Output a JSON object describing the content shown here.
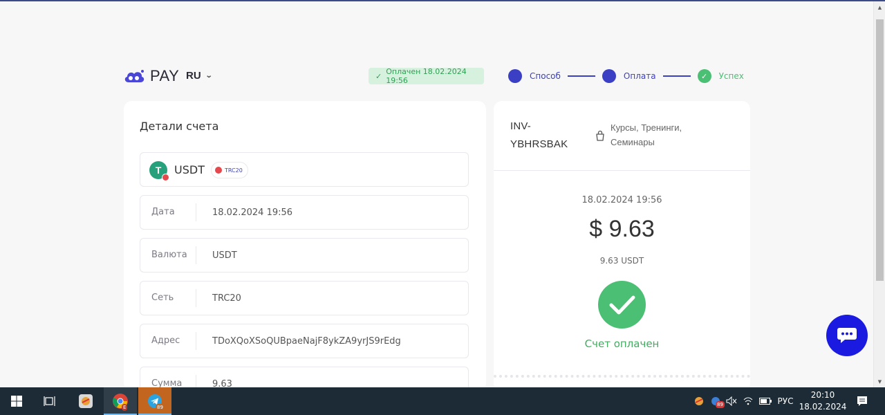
{
  "header": {
    "logo_text": "PAY",
    "lang": "RU",
    "status_badge": "Оплачен 18.02.2024 19:56",
    "steps": [
      {
        "label": "Способ",
        "state": "active"
      },
      {
        "label": "Оплата",
        "state": "active"
      },
      {
        "label": "Успех",
        "state": "done"
      }
    ]
  },
  "details": {
    "title": "Детали счета",
    "coin": {
      "name": "USDT",
      "network": "TRC20"
    },
    "rows": [
      {
        "label": "Дата",
        "value": "18.02.2024 19:56"
      },
      {
        "label": "Валюта",
        "value": "USDT"
      },
      {
        "label": "Сеть",
        "value": "TRC20"
      },
      {
        "label": "Адрес",
        "value": "TDoXQoXSoQUBpaeNajF8ykZA9yrJS9rEdg"
      },
      {
        "label": "Сумма",
        "value": "9.63"
      }
    ]
  },
  "invoice": {
    "id": "INV-YBHRSBAK",
    "category": "Курсы, Тренинги, Семинары",
    "date": "18.02.2024 19:56",
    "amount": "$ 9.63",
    "crypto_amount": "9.63 USDT",
    "status_text": "Счет оплачен"
  },
  "taskbar": {
    "telegram_badge": "89",
    "browser_badge": "E",
    "tray_badge": "89",
    "lang": "РУС",
    "time": "20:10",
    "date": "18.02.2024"
  },
  "colors": {
    "accent": "#3b3fc4",
    "success": "#4bbf73",
    "chat": "#1a1ae0",
    "taskbar": "#1c2b35"
  },
  "icons": [
    "cloud-logo-icon",
    "chevron-down-icon",
    "check-icon",
    "tether-icon",
    "bag-icon",
    "chat-icon",
    "windows-icon",
    "task-view-icon",
    "chrome-icon",
    "telegram-icon",
    "volume-icon",
    "wifi-icon",
    "battery-icon",
    "notification-icon"
  ]
}
